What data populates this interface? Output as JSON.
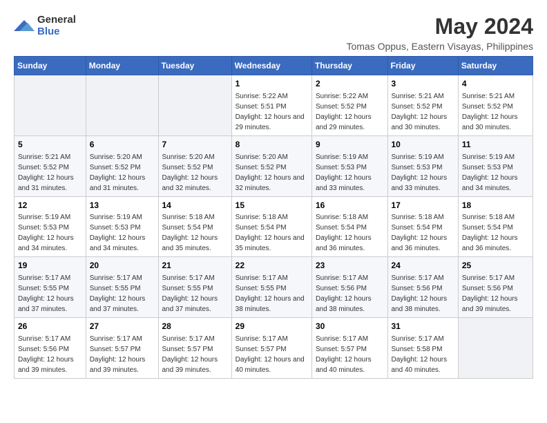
{
  "logo": {
    "line1": "General",
    "line2": "Blue"
  },
  "title": "May 2024",
  "subtitle": "Tomas Oppus, Eastern Visayas, Philippines",
  "days_of_week": [
    "Sunday",
    "Monday",
    "Tuesday",
    "Wednesday",
    "Thursday",
    "Friday",
    "Saturday"
  ],
  "weeks": [
    [
      {
        "num": "",
        "sunrise": "",
        "sunset": "",
        "daylight": "",
        "empty": true
      },
      {
        "num": "",
        "sunrise": "",
        "sunset": "",
        "daylight": "",
        "empty": true
      },
      {
        "num": "",
        "sunrise": "",
        "sunset": "",
        "daylight": "",
        "empty": true
      },
      {
        "num": "1",
        "sunrise": "Sunrise: 5:22 AM",
        "sunset": "Sunset: 5:51 PM",
        "daylight": "Daylight: 12 hours and 29 minutes."
      },
      {
        "num": "2",
        "sunrise": "Sunrise: 5:22 AM",
        "sunset": "Sunset: 5:52 PM",
        "daylight": "Daylight: 12 hours and 29 minutes."
      },
      {
        "num": "3",
        "sunrise": "Sunrise: 5:21 AM",
        "sunset": "Sunset: 5:52 PM",
        "daylight": "Daylight: 12 hours and 30 minutes."
      },
      {
        "num": "4",
        "sunrise": "Sunrise: 5:21 AM",
        "sunset": "Sunset: 5:52 PM",
        "daylight": "Daylight: 12 hours and 30 minutes."
      }
    ],
    [
      {
        "num": "5",
        "sunrise": "Sunrise: 5:21 AM",
        "sunset": "Sunset: 5:52 PM",
        "daylight": "Daylight: 12 hours and 31 minutes."
      },
      {
        "num": "6",
        "sunrise": "Sunrise: 5:20 AM",
        "sunset": "Sunset: 5:52 PM",
        "daylight": "Daylight: 12 hours and 31 minutes."
      },
      {
        "num": "7",
        "sunrise": "Sunrise: 5:20 AM",
        "sunset": "Sunset: 5:52 PM",
        "daylight": "Daylight: 12 hours and 32 minutes."
      },
      {
        "num": "8",
        "sunrise": "Sunrise: 5:20 AM",
        "sunset": "Sunset: 5:52 PM",
        "daylight": "Daylight: 12 hours and 32 minutes."
      },
      {
        "num": "9",
        "sunrise": "Sunrise: 5:19 AM",
        "sunset": "Sunset: 5:53 PM",
        "daylight": "Daylight: 12 hours and 33 minutes."
      },
      {
        "num": "10",
        "sunrise": "Sunrise: 5:19 AM",
        "sunset": "Sunset: 5:53 PM",
        "daylight": "Daylight: 12 hours and 33 minutes."
      },
      {
        "num": "11",
        "sunrise": "Sunrise: 5:19 AM",
        "sunset": "Sunset: 5:53 PM",
        "daylight": "Daylight: 12 hours and 34 minutes."
      }
    ],
    [
      {
        "num": "12",
        "sunrise": "Sunrise: 5:19 AM",
        "sunset": "Sunset: 5:53 PM",
        "daylight": "Daylight: 12 hours and 34 minutes."
      },
      {
        "num": "13",
        "sunrise": "Sunrise: 5:19 AM",
        "sunset": "Sunset: 5:53 PM",
        "daylight": "Daylight: 12 hours and 34 minutes."
      },
      {
        "num": "14",
        "sunrise": "Sunrise: 5:18 AM",
        "sunset": "Sunset: 5:54 PM",
        "daylight": "Daylight: 12 hours and 35 minutes."
      },
      {
        "num": "15",
        "sunrise": "Sunrise: 5:18 AM",
        "sunset": "Sunset: 5:54 PM",
        "daylight": "Daylight: 12 hours and 35 minutes."
      },
      {
        "num": "16",
        "sunrise": "Sunrise: 5:18 AM",
        "sunset": "Sunset: 5:54 PM",
        "daylight": "Daylight: 12 hours and 36 minutes."
      },
      {
        "num": "17",
        "sunrise": "Sunrise: 5:18 AM",
        "sunset": "Sunset: 5:54 PM",
        "daylight": "Daylight: 12 hours and 36 minutes."
      },
      {
        "num": "18",
        "sunrise": "Sunrise: 5:18 AM",
        "sunset": "Sunset: 5:54 PM",
        "daylight": "Daylight: 12 hours and 36 minutes."
      }
    ],
    [
      {
        "num": "19",
        "sunrise": "Sunrise: 5:17 AM",
        "sunset": "Sunset: 5:55 PM",
        "daylight": "Daylight: 12 hours and 37 minutes."
      },
      {
        "num": "20",
        "sunrise": "Sunrise: 5:17 AM",
        "sunset": "Sunset: 5:55 PM",
        "daylight": "Daylight: 12 hours and 37 minutes."
      },
      {
        "num": "21",
        "sunrise": "Sunrise: 5:17 AM",
        "sunset": "Sunset: 5:55 PM",
        "daylight": "Daylight: 12 hours and 37 minutes."
      },
      {
        "num": "22",
        "sunrise": "Sunrise: 5:17 AM",
        "sunset": "Sunset: 5:55 PM",
        "daylight": "Daylight: 12 hours and 38 minutes."
      },
      {
        "num": "23",
        "sunrise": "Sunrise: 5:17 AM",
        "sunset": "Sunset: 5:56 PM",
        "daylight": "Daylight: 12 hours and 38 minutes."
      },
      {
        "num": "24",
        "sunrise": "Sunrise: 5:17 AM",
        "sunset": "Sunset: 5:56 PM",
        "daylight": "Daylight: 12 hours and 38 minutes."
      },
      {
        "num": "25",
        "sunrise": "Sunrise: 5:17 AM",
        "sunset": "Sunset: 5:56 PM",
        "daylight": "Daylight: 12 hours and 39 minutes."
      }
    ],
    [
      {
        "num": "26",
        "sunrise": "Sunrise: 5:17 AM",
        "sunset": "Sunset: 5:56 PM",
        "daylight": "Daylight: 12 hours and 39 minutes."
      },
      {
        "num": "27",
        "sunrise": "Sunrise: 5:17 AM",
        "sunset": "Sunset: 5:57 PM",
        "daylight": "Daylight: 12 hours and 39 minutes."
      },
      {
        "num": "28",
        "sunrise": "Sunrise: 5:17 AM",
        "sunset": "Sunset: 5:57 PM",
        "daylight": "Daylight: 12 hours and 39 minutes."
      },
      {
        "num": "29",
        "sunrise": "Sunrise: 5:17 AM",
        "sunset": "Sunset: 5:57 PM",
        "daylight": "Daylight: 12 hours and 40 minutes."
      },
      {
        "num": "30",
        "sunrise": "Sunrise: 5:17 AM",
        "sunset": "Sunset: 5:57 PM",
        "daylight": "Daylight: 12 hours and 40 minutes."
      },
      {
        "num": "31",
        "sunrise": "Sunrise: 5:17 AM",
        "sunset": "Sunset: 5:58 PM",
        "daylight": "Daylight: 12 hours and 40 minutes."
      },
      {
        "num": "",
        "sunrise": "",
        "sunset": "",
        "daylight": "",
        "empty": true
      }
    ]
  ]
}
